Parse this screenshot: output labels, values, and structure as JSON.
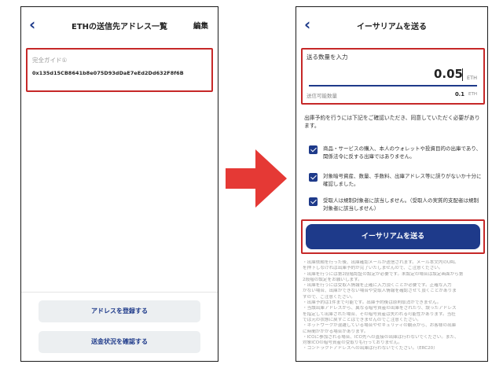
{
  "left": {
    "title": "ETHの送信先アドレス一覧",
    "edit_label": "編集",
    "guide_label": "完全ガイド①",
    "address": "0x135d15CB8641b8e075D93dDaE7eEd2Dd632F8f6B",
    "register_button": "アドレスを登録する",
    "status_button": "送金状況を確認する"
  },
  "right": {
    "title": "イーサリアムを送る",
    "amount_label": "送る数量を入力",
    "amount_value": "0.05",
    "amount_unit": "ETH",
    "available_label": "送信可能数量",
    "available_value": "0.1",
    "available_unit": "ETH",
    "notice": "出庫予約を行うには下記をご確認いただき、同意していただく必要があります。",
    "checks": [
      "商品・サービスの購入、本人のウォレットや投資目的の出庫であり、関係法令に反する出庫ではありません。",
      "対象暗号資産、数量、手数料、出庫アドレス等に誤りがないか十分に確認しました。",
      "受取人は規制対象者に該当しません。（受取人の実質的支配者は規制対象者に該当しません）"
    ],
    "send_button": "イーサリアムを送る",
    "fine_print": [
      "・出庫依頼を行った後、出庫確認メールが送信されます。メール本文内のURL",
      "を押下しなければ出庫予約が完了いたしませんので、ご注意ください。",
      "・出庫を行うには第2段階認証の設定が必要です。未設定の場合は設定画面から第",
      "2段階の設定をお願いします。",
      "・出庫を行うには受取人情報を正確に入力頂くことが必要です。正確な入力",
      "がない場合、出庫ができない場合や受取人情報を確認させて頂くことがありま",
      "すので、ご注意ください。",
      "・出庫予約は1件まで可能です。出庫予約後は原則取消ができません。",
      "・当該出庫アドレスから、異なる暗号資産の出庫をされたり、誤ったアドレス",
      "を指定して出庫された場合、その暗号資産は失われる可能性があります。当社",
      "では元の状態に戻すことはできませんのでご注意ください。",
      "・ネットワークが混雑している場合やセキュリティの観点から、お客様の出庫",
      "に時間がかかる場合があります。",
      "・ICOに参加される場合、ICO先への直接の出庫は行わないでください。また、",
      "対象ICOの暗号資産の受取りも行っておりません。",
      "・コントラクトアドレスへの出庫は行わないでください。（ERC20）"
    ]
  },
  "colors": {
    "accent": "#1e3a8a",
    "highlight": "#c62828",
    "arrow": "#e53935"
  }
}
